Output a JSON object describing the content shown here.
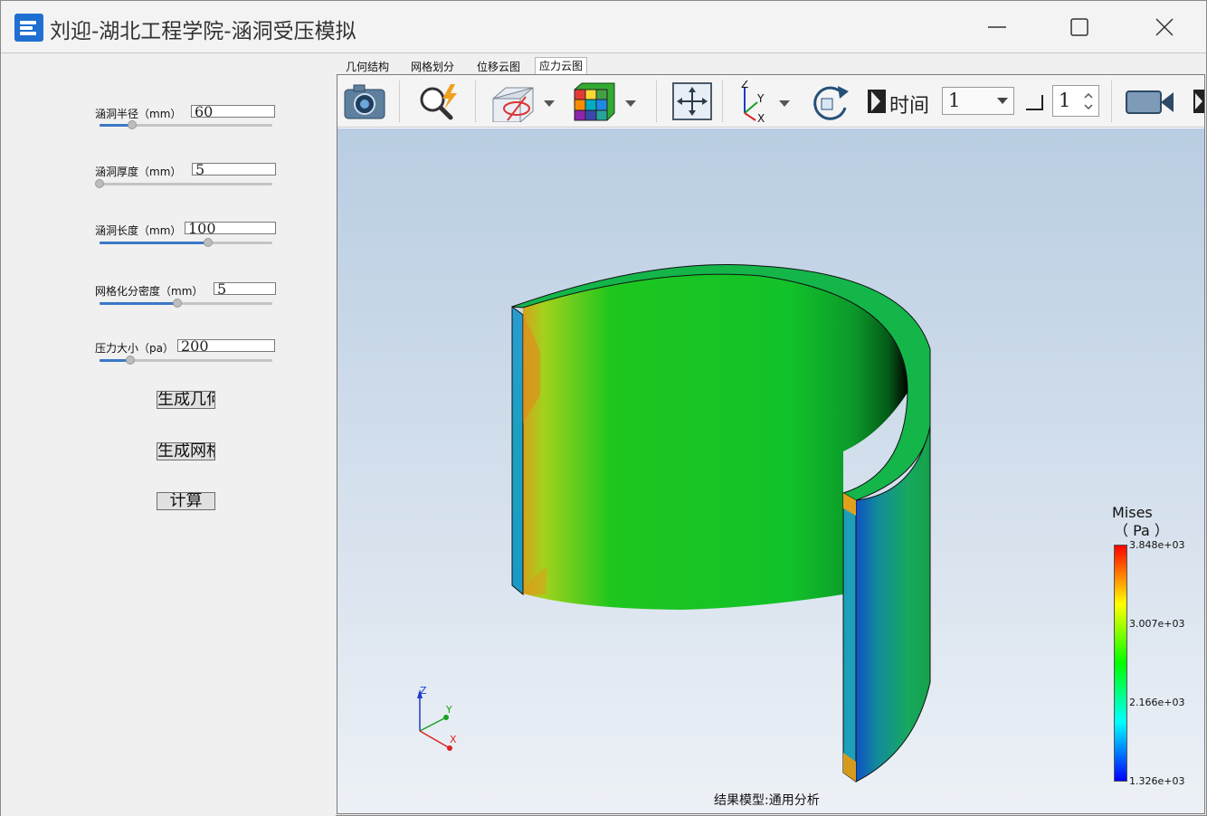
{
  "window": {
    "title": "刘迎-湖北工程学院-涵洞受压模拟",
    "icon": "app-logo-icon"
  },
  "params": [
    {
      "label": "涵洞半径（mm）",
      "value": "60",
      "slider_fraction": 0.19
    },
    {
      "label": "涵洞厚度（mm）",
      "value": "5",
      "slider_fraction": 0.0
    },
    {
      "label": "涵洞长度（mm）",
      "value": "100",
      "slider_fraction": 0.63
    },
    {
      "label": "网格化分密度（mm）",
      "value": "5",
      "slider_fraction": 0.45
    },
    {
      "label": "压力大小（pa）",
      "value": "200",
      "slider_fraction": 0.18
    }
  ],
  "buttons": {
    "generate_geometry": "生成几何",
    "generate_mesh": "生成网格",
    "compute": "计算"
  },
  "tabs": [
    "几何结构",
    "网格划分",
    "位移云图",
    "应力云图"
  ],
  "active_tab": "应力云图",
  "toolbar": {
    "time_label": "时间",
    "time_value": "1",
    "step_value": "1",
    "icons": [
      "camera-icon",
      "query-magnifier-icon",
      "clip-plane-icon",
      "mesh-cube-icon",
      "fit-view-icon",
      "axes-orientation-icon",
      "rotate-view-icon",
      "animation-icon",
      "video-record-icon"
    ]
  },
  "viewport": {
    "footer": "结果模型:通用分析",
    "triad": {
      "z": "Z",
      "y": "Y",
      "x": "X"
    }
  },
  "legend": {
    "title": "Mises",
    "unit": "（ Pa ）",
    "ticks": [
      "3.848e+03",
      "3.007e+03",
      "2.166e+03",
      "1.326e+03"
    ]
  },
  "colors": {
    "accent": "#1f6fd1",
    "slider_fill": "#3b78c6",
    "stress_green": "#16c826",
    "stress_blue": "#0d48b8"
  }
}
